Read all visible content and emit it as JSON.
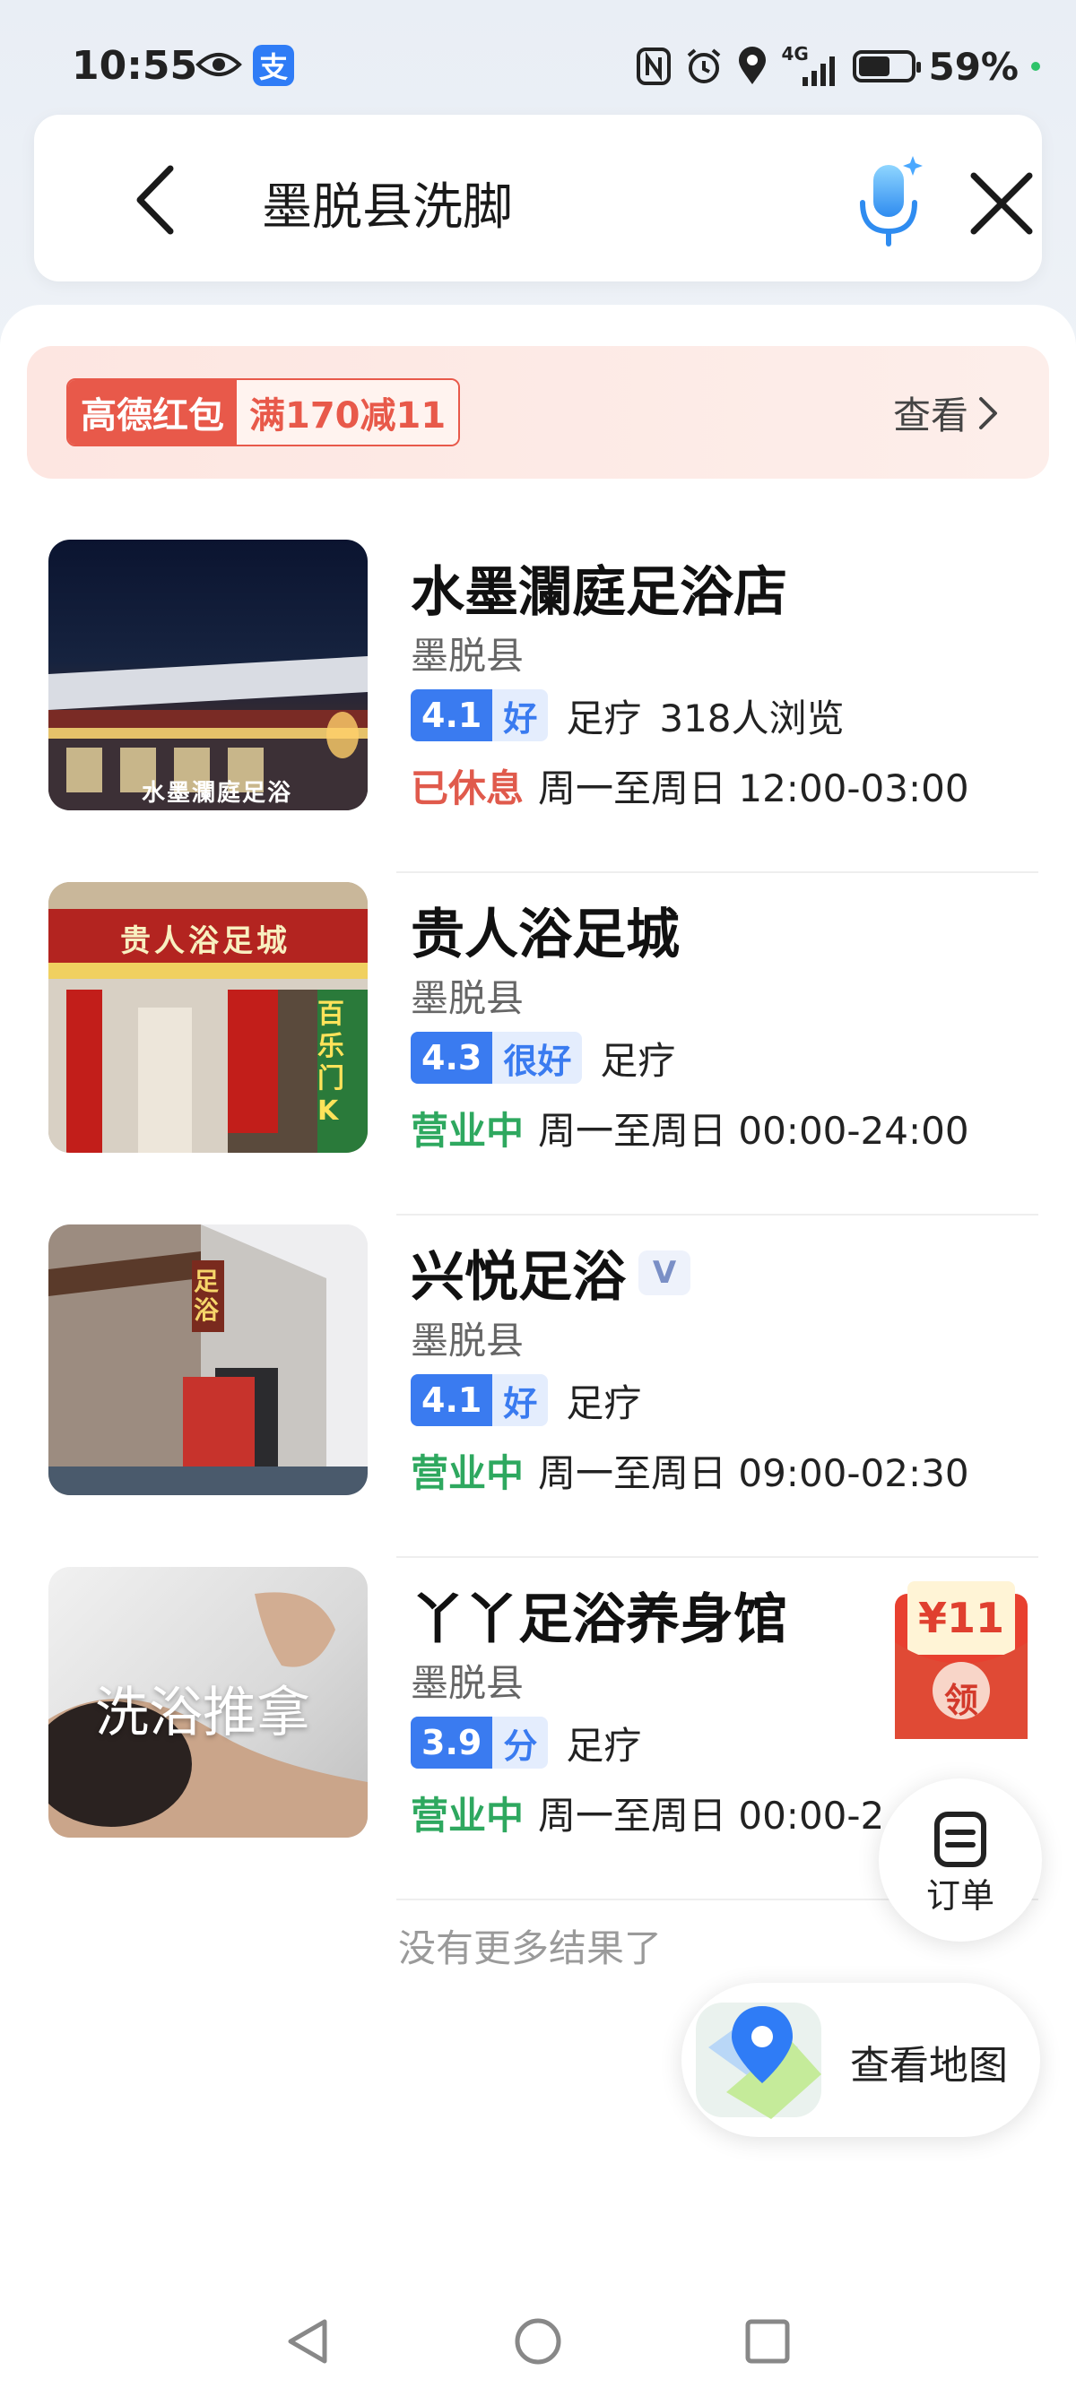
{
  "status_bar": {
    "time": "10:55",
    "alipay_icon_label": "支",
    "network": "4G",
    "battery_percent": "59%",
    "battery_level": 0.59
  },
  "search": {
    "query": "墨脱县洗脚",
    "back_icon": "chevron-left-icon",
    "mic_icon": "mic-icon",
    "clear_icon": "close-icon"
  },
  "promo": {
    "badge_label": "高德红包",
    "offer": "满170减11",
    "view_label": "查看"
  },
  "results": [
    {
      "name": "水墨瀾庭足浴店",
      "area": "墨脱县",
      "score": "4.1",
      "rating_word": "好",
      "category": "足疗",
      "views": "318人浏览",
      "status": "已休息",
      "status_type": "closed",
      "hours": "周一至周日 12:00-03:00",
      "thumb_sign": "水墨瀾庭足浴"
    },
    {
      "name": "贵人浴足城",
      "area": "墨脱县",
      "score": "4.3",
      "rating_word": "很好",
      "category": "足疗",
      "status": "营业中",
      "status_type": "open",
      "hours": "周一至周日 00:00-24:00",
      "thumb_sign": "贵人浴足城",
      "thumb_side_sign": "百乐门K"
    },
    {
      "name": "兴悦足浴",
      "verified_badge": "V",
      "area": "墨脱县",
      "score": "4.1",
      "rating_word": "好",
      "category": "足疗",
      "status": "营业中",
      "status_type": "open",
      "hours": "周一至周日 09:00-02:30",
      "thumb_sign": "足浴"
    },
    {
      "name": "丫丫足浴养身馆",
      "area": "墨脱县",
      "score": "3.9",
      "rating_word": "分",
      "category": "足疗",
      "status": "营业中",
      "status_type": "open",
      "hours": "周一至周日 00:00-2",
      "thumb_caption": "洗浴推拿"
    }
  ],
  "coupon": {
    "amount": "¥11",
    "claim_label": "领"
  },
  "no_more_text": "没有更多结果了",
  "order_button": {
    "label": "订单"
  },
  "map_button": {
    "label": "查看地图"
  },
  "colors": {
    "brand_blue": "#3a7bf0",
    "promo_red": "#e8594a",
    "open_green": "#2ea85f",
    "closed_red": "#e05a4c"
  }
}
